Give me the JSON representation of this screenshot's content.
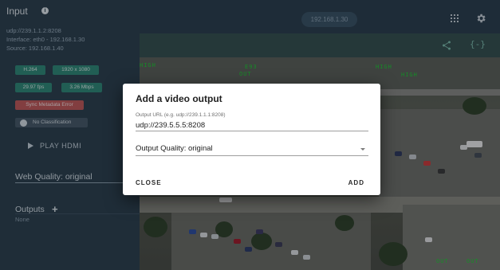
{
  "topbar": {
    "ip": "192.168.1.30",
    "apps_icon": "grid-icon",
    "settings_icon": "gear-icon"
  },
  "video": {
    "share_icon": "share-icon",
    "code_icon_text": "{-}",
    "overlay_labels": [
      "E93",
      "OUT",
      "HIGH",
      "HIGH",
      "HIGH",
      "OUT",
      "OUT"
    ]
  },
  "sidebar": {
    "title": "Input",
    "url": "udp://239.1.1.2:8208",
    "interface": "Interface: eth0 - 192.168.1.30",
    "source": "Source: 192.168.1.40",
    "chips": {
      "codec": "H.264",
      "resolution": "1920 x 1080",
      "fps": "29.97 fps",
      "bitrate": "3.26 Mbps",
      "sync_error": "Sync Metadata Error",
      "classification": "No Classification"
    },
    "play_label": "PLAY HDMI",
    "web_quality": "Web Quality: original",
    "outputs_title": "Outputs",
    "outputs_empty": "None"
  },
  "dialog": {
    "title": "Add a video output",
    "url_label": "Output URL (e.g. udp://239.1.1.1:8208)",
    "url_value": "udp://239.5.5.5:8208",
    "quality_value": "Output Quality: original",
    "close_label": "CLOSE",
    "add_label": "ADD"
  }
}
